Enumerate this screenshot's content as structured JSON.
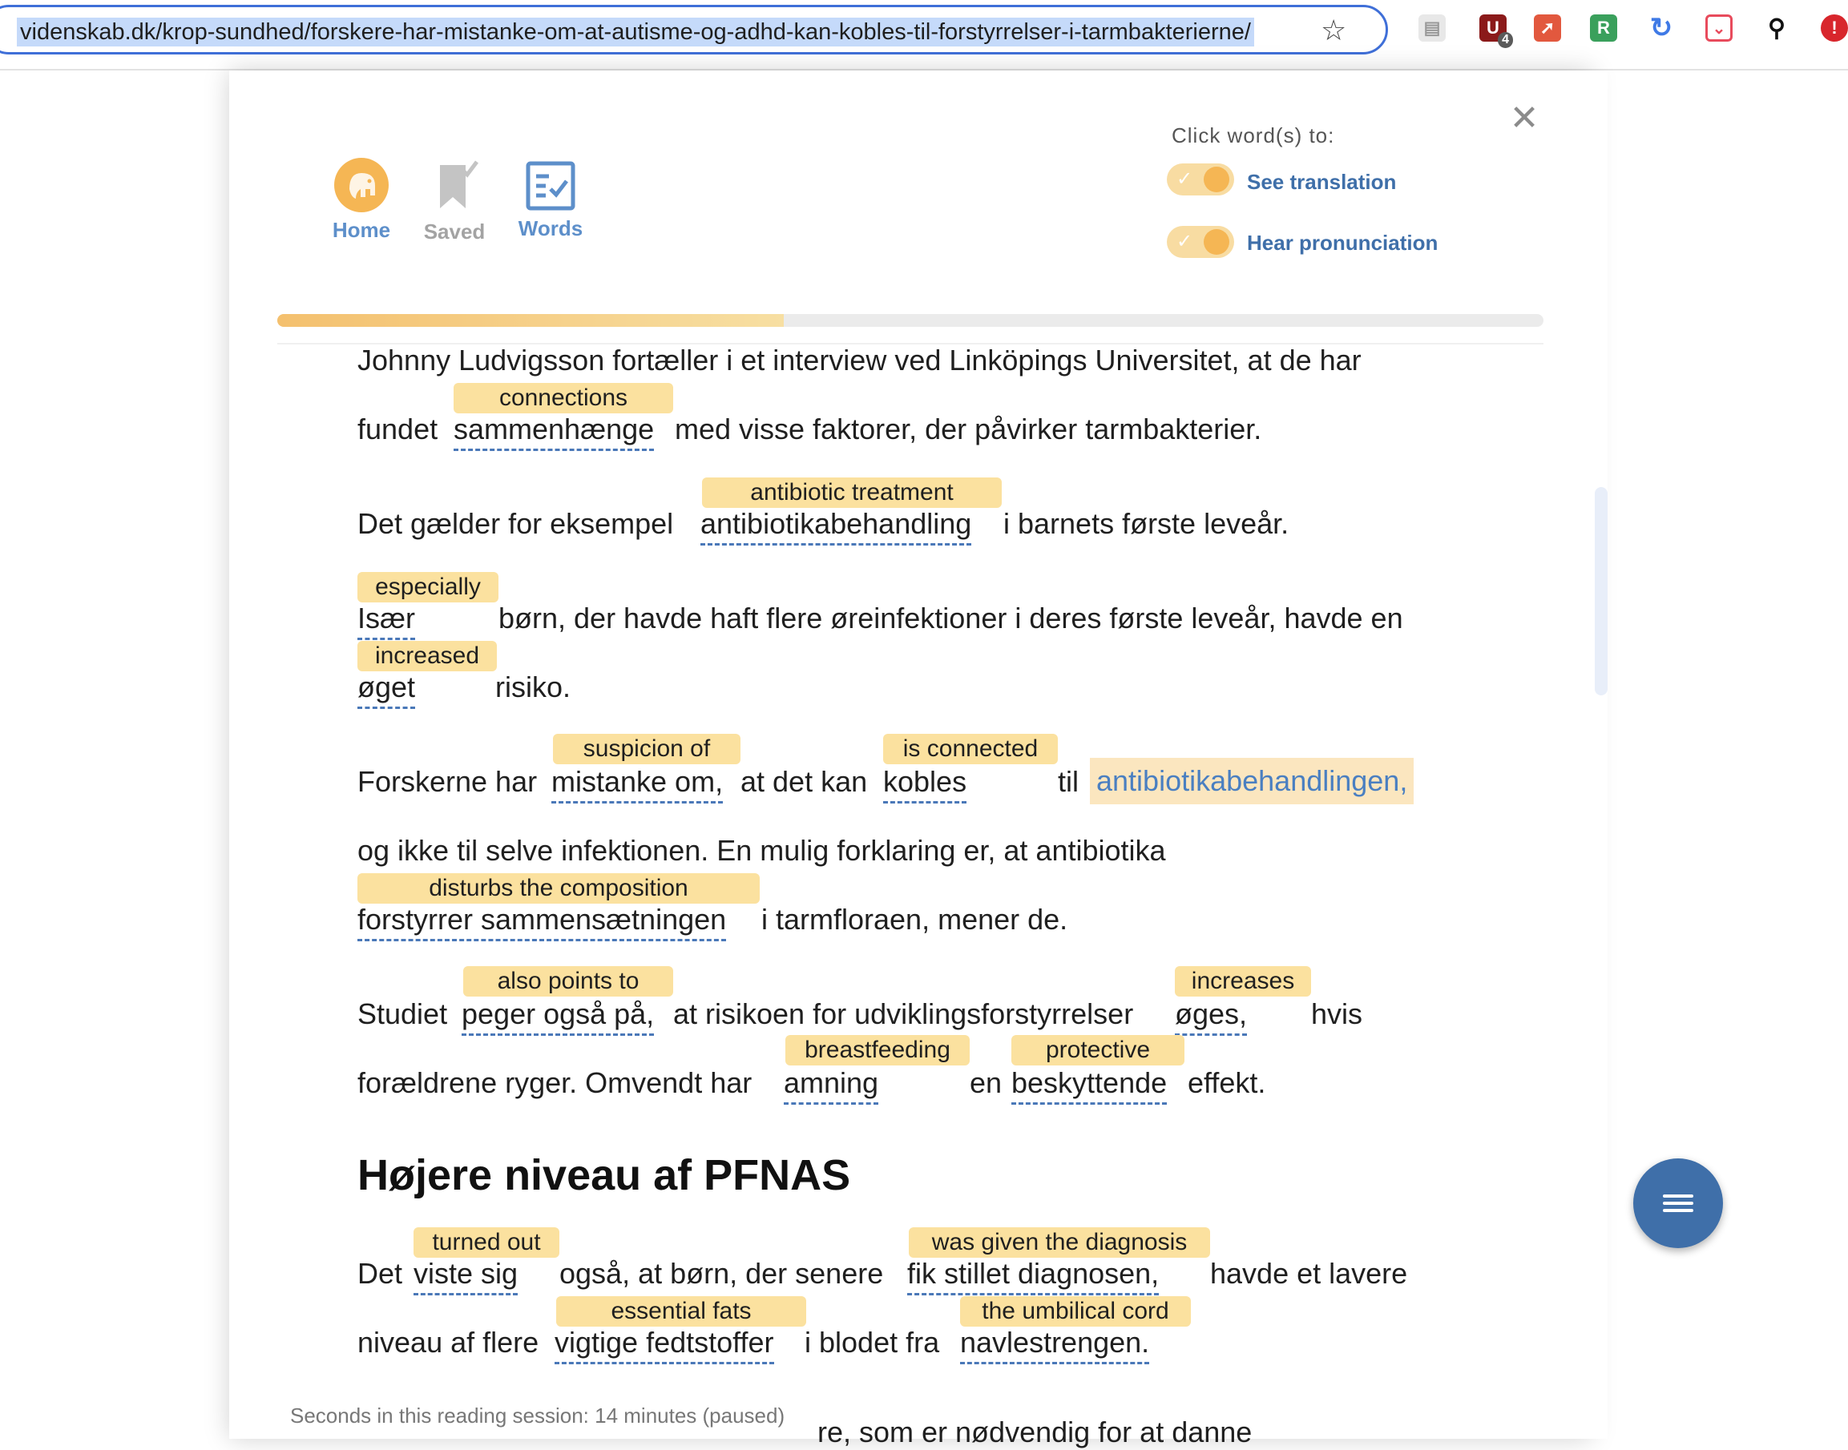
{
  "browser": {
    "url": "videnskab.dk/krop-sundhed/forskere-har-mistanke-om-at-autisme-og-adhd-kan-kobles-til-forstyrrelser-i-tarmbakterierne/",
    "extensions": [
      {
        "name": "ublock-icon",
        "badge": "4",
        "color": "#8b1a1a"
      },
      {
        "name": "rocket-icon",
        "color": "#e2583e"
      },
      {
        "name": "r-icon",
        "letter": "R",
        "color": "#3aa05c"
      },
      {
        "name": "refresh-icon",
        "color": "#3f7ae6"
      },
      {
        "name": "pocket-icon",
        "color": "#e84b5c"
      },
      {
        "name": "pin-icon",
        "color": "#111111"
      }
    ]
  },
  "nav": {
    "home": "Home",
    "saved": "Saved",
    "words": "Words"
  },
  "settings": {
    "heading": "Click word(s) to:",
    "translation_label": "See translation",
    "pronunciation_label": "Hear pronunciation"
  },
  "progress": {
    "fraction": 0.4
  },
  "text": {
    "p1_l1": "Johnny Ludvigsson fortæller i et interview ved Linköpings Universitet, at de har",
    "p1_l2a": "fundet",
    "p1_w1": "sammenhænge",
    "p1_t1": "connections",
    "p1_l2b": "med visse faktorer, der påvirker tarmbakterier.",
    "p2_a": "Det gælder for eksempel",
    "p2_w1": "antibiotikabehandling",
    "p2_t1": "antibiotic treatment",
    "p2_b": "i barnets første leveår.",
    "p3_w1": "Især",
    "p3_t1": "especially",
    "p3_a": "børn, der havde haft flere øreinfektioner i deres første leveår, havde en",
    "p3_w2": "øget",
    "p3_t2": "increased",
    "p3_b": "risiko.",
    "p4_a": "Forskerne har",
    "p4_w1": "mistanke om,",
    "p4_t1": "suspicion of",
    "p4_b": "at det kan",
    "p4_w2": "kobles",
    "p4_t2": "is connected",
    "p4_c": "til",
    "p4_w3": "antibiotikabehandlingen,",
    "p4_l2": "og ikke til selve infektionen. En mulig forklaring er, at antibiotika",
    "p4_w4": "forstyrrer sammensætningen",
    "p4_t4": "disturbs the composition",
    "p4_d": "i tarmfloraen, mener de.",
    "p5_a": "Studiet",
    "p5_w1": "peger også på,",
    "p5_t1": "also points to",
    "p5_b": "at risikoen for udviklingsforstyrrelser",
    "p5_w2": "øges,",
    "p5_t2": "increases",
    "p5_c": "hvis",
    "p5_d": "forældrene ryger. Omvendt har",
    "p5_w3": "amning",
    "p5_t3": "breastfeeding",
    "p5_e": "en",
    "p5_w4": "beskyttende",
    "p5_t4": "protective",
    "p5_f": "effekt.",
    "heading": "Højere niveau af PFNAS",
    "p6_a": "Det",
    "p6_w1": "viste sig",
    "p6_t1": "turned out",
    "p6_b": "også, at børn, der senere",
    "p6_w2": "fik stillet diagnosen,",
    "p6_t2": "was given the diagnosis",
    "p6_c": "havde et lavere",
    "p6_d": "niveau af flere",
    "p6_w3": "vigtige fedtstoffer",
    "p6_t3": "essential fats",
    "p6_e": "i blodet fra",
    "p6_w4": "navlestrengen.",
    "p6_t4": "the umbilical cord",
    "p6_partial": "re, som er nødvendig for at danne"
  },
  "session": "Seconds in this reading session: 14 minutes (paused)",
  "colors": {
    "accent_blue": "#3f6fa9",
    "highlight": "#fbe19f",
    "orange": "#f5b654"
  }
}
